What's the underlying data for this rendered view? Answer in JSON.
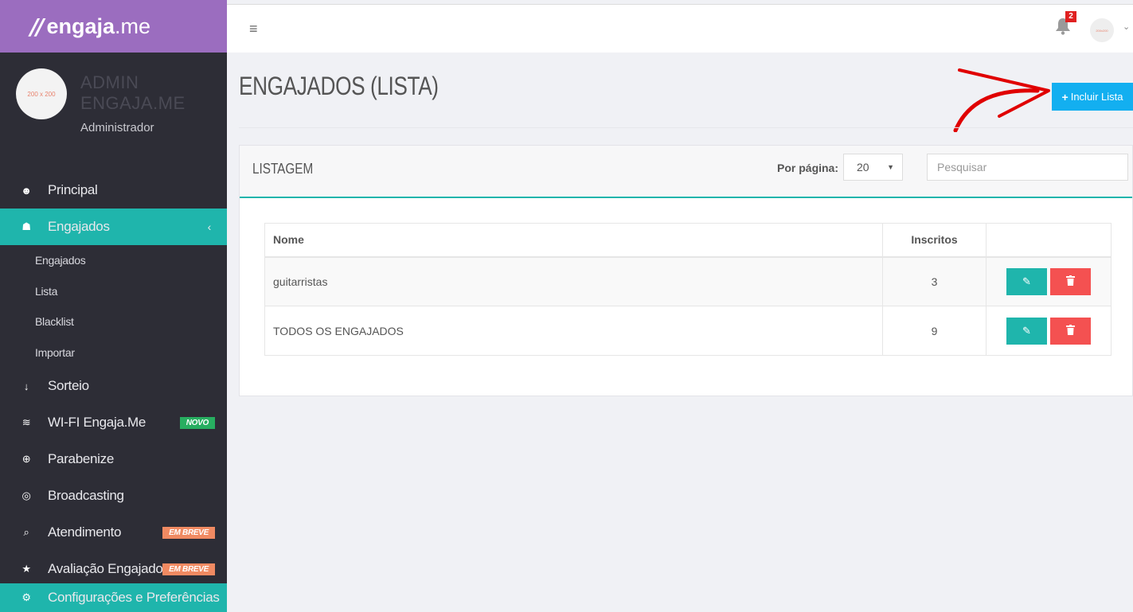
{
  "brand": {
    "mark": "//",
    "name_bold": "engaja",
    "name_thin": ".me"
  },
  "user": {
    "avatar_text": "200 x 200",
    "name_line1": "ADMIN",
    "name_line2": "ENGAJA.ME",
    "role": "Administrador"
  },
  "sidebar": {
    "items": [
      {
        "label": "Principal",
        "icon": "dashboard-icon",
        "glyph": "☻"
      },
      {
        "label": "Engajados",
        "icon": "users-icon",
        "glyph": "☗",
        "chevron": "‹"
      },
      {
        "label": "Sorteio",
        "icon": "sort-numeric-icon",
        "glyph": "↓"
      },
      {
        "label": "WI-FI Engaja.Me",
        "icon": "wifi-icon",
        "glyph": "≋",
        "badge": "NOVO"
      },
      {
        "label": "Parabenize",
        "icon": "gift-icon",
        "glyph": "⊕"
      },
      {
        "label": "Broadcasting",
        "icon": "compass-icon",
        "glyph": "◎"
      },
      {
        "label": "Atendimento",
        "icon": "comments-icon",
        "glyph": "⌕",
        "badge": "EM BREVE"
      },
      {
        "label": "Avaliação Engajados",
        "icon": "star-icon",
        "glyph": "★",
        "badge": "EM BREVE"
      },
      {
        "label": "Configurações e Preferências",
        "icon": "gear-icon",
        "glyph": "⚙"
      }
    ],
    "submenu": [
      "Engajados",
      "Lista",
      "Blacklist",
      "Importar"
    ]
  },
  "topbar": {
    "menu_glyph": "≡",
    "notifications": "2",
    "avatar_text": "200x200",
    "caret": "⌄"
  },
  "page": {
    "title": "ENGAJADOS (LISTA)",
    "add_button": "Incluir Lista",
    "add_glyph": "+"
  },
  "panel": {
    "title": "LISTAGEM",
    "per_page_label": "Por página:",
    "per_page_value": "20",
    "search_placeholder": "Pesquisar",
    "columns": [
      "Nome",
      "Inscritos",
      ""
    ],
    "rows": [
      {
        "nome": "guitarristas",
        "inscritos": "3"
      },
      {
        "nome": "TODOS OS ENGAJADOS",
        "inscritos": "9"
      }
    ]
  },
  "colors": {
    "brand_purple": "#9b6dbf",
    "sidebar_bg": "#2d2d36",
    "teal": "#1fb5ac",
    "blue_button": "#13aff0",
    "danger": "#f45151",
    "annotation_arrow": "#e00000"
  }
}
